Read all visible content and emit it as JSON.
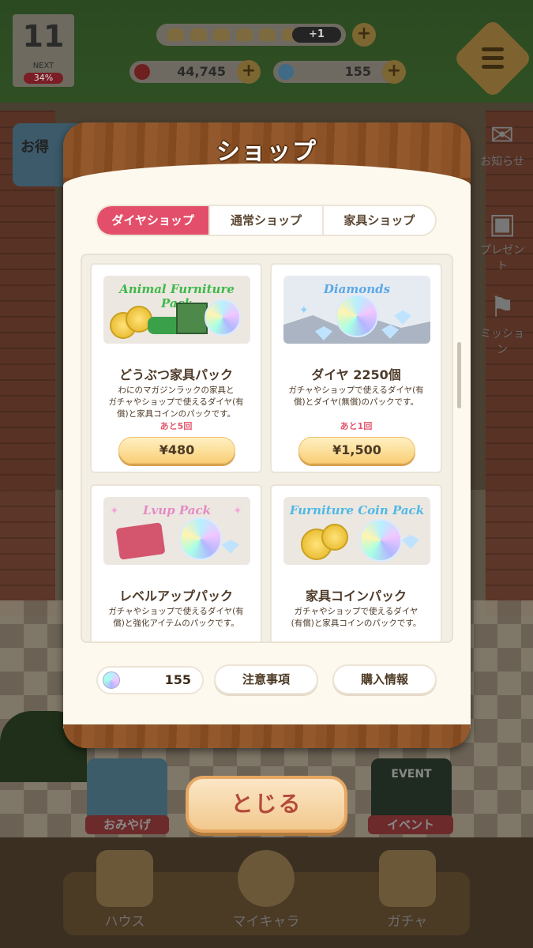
{
  "hud": {
    "level": "11",
    "next_label": "NEXT",
    "next_percent": "34%",
    "stamina_bonus": "+1",
    "stars": "44,745",
    "gems": "155",
    "plus_symbol": "+"
  },
  "side_menu": {
    "news": "お知らせ",
    "present": "プレゼント",
    "mission": "ミッション"
  },
  "promo": {
    "label": "お得"
  },
  "shop": {
    "title": "ショップ",
    "tabs": [
      {
        "label": "ダイヤショップ",
        "active": true
      },
      {
        "label": "通常ショップ",
        "active": false
      },
      {
        "label": "家具ショップ",
        "active": false
      }
    ],
    "items": [
      {
        "banner": "Animal Furniture Pack",
        "name": "どうぶつ家具パック",
        "desc_line1": "わにのマガジンラックの家具と",
        "desc_line2": "ガチャやショップで使えるダイヤ(有",
        "desc_line3": "償)と家具コインのパックです。",
        "remaining": "あと5回",
        "price": "¥480"
      },
      {
        "banner": "Diamonds",
        "name": "ダイヤ 2250個",
        "desc_line1": "ガチャやショップで使えるダイヤ(有",
        "desc_line2": "償)とダイヤ(無償)のパックです。",
        "desc_line3": "",
        "remaining": "あと1回",
        "price": "¥1,500"
      },
      {
        "banner": "Lvup Pack",
        "name": "レベルアップパック",
        "desc_line1": "ガチャやショップで使えるダイヤ(有",
        "desc_line2": "償)と強化アイテムのパックです。",
        "desc_line3": ""
      },
      {
        "banner": "Furniture Coin Pack",
        "name": "家具コインパック",
        "desc_line1": "ガチャやショップで使えるダイヤ",
        "desc_line2": "(有償)と家具コインのパックです。",
        "desc_line3": ""
      }
    ],
    "gem_balance": "155",
    "notes_button": "注意事項",
    "purchase_info_button": "購入情報",
    "close_button": "とじる"
  },
  "bottom": {
    "souvenir": "おみやげ",
    "event": "イベント",
    "event_sign": "EVENT",
    "nav": [
      {
        "label": "ハウス"
      },
      {
        "label": "マイキャラ"
      },
      {
        "label": "ガチャ"
      }
    ]
  },
  "colors": {
    "accent_tab": "#e34f6a",
    "dialog_wood": "#7a4720",
    "price_button": "#f9cf77",
    "remaining_text": "#e2566d"
  },
  "icons": {
    "menu": "hamburger-icon",
    "news": "envelope-icon",
    "present": "gift-icon",
    "mission": "flag-icon",
    "gem": "diamond-icon",
    "star": "star-icon"
  }
}
